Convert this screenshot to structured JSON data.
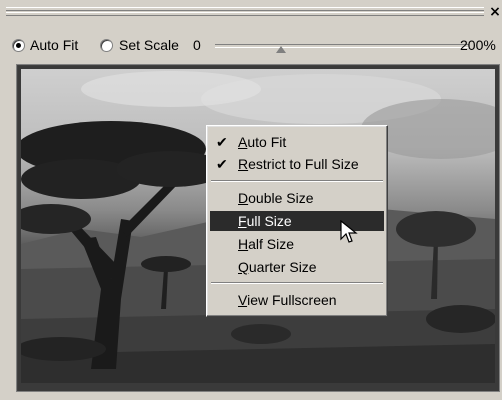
{
  "window": {
    "close_label": "×"
  },
  "toolbar": {
    "auto_fit_label": "Auto Fit",
    "set_scale_label": "Set Scale",
    "auto_fit_selected": true,
    "slider_min_label": "0",
    "slider_max_label": "200%"
  },
  "context_menu": {
    "items": [
      {
        "label": "Auto Fit",
        "checked": true
      },
      {
        "label": "Restrict to Full Size",
        "checked": true
      },
      {
        "label": "Double Size",
        "checked": false
      },
      {
        "label": "Full Size",
        "checked": false,
        "highlighted": true
      },
      {
        "label": "Half Size",
        "checked": false
      },
      {
        "label": "Quarter Size",
        "checked": false
      },
      {
        "label": "View Fullscreen",
        "checked": false
      }
    ],
    "check_glyph": "✔"
  },
  "colors": {
    "window_bg": "#d4d0c8",
    "menu_highlight": "#2b2b2b",
    "menu_highlight_text": "#ffffff"
  },
  "icons": {
    "close": "close-icon",
    "cursor": "mouse-pointer-icon",
    "check": "checkmark-icon"
  }
}
